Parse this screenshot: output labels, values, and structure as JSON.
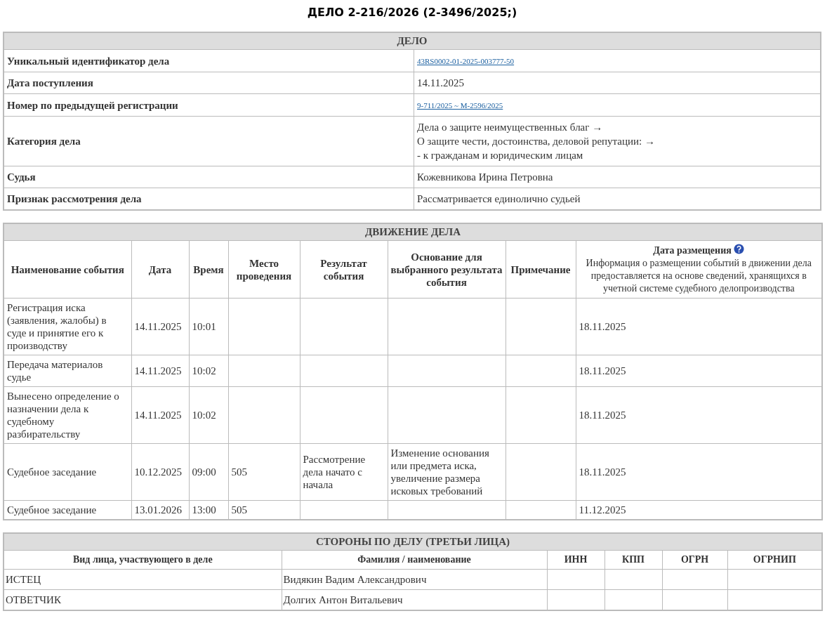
{
  "title": "ДЕЛО 2-216/2026 (2-3496/2025;)",
  "case": {
    "heading": "ДЕЛО",
    "rows": [
      {
        "label": "Уникальный идентификатор дела",
        "kind": "link",
        "lines": [
          "43RS0002-01-2025-003777-50"
        ]
      },
      {
        "label": "Дата поступления",
        "kind": "text",
        "lines": [
          "14.11.2025"
        ]
      },
      {
        "label": "Номер по предыдущей регистрации",
        "kind": "link",
        "lines": [
          "9-711/2025 ~ М-2596/2025"
        ]
      },
      {
        "label": "Категория дела",
        "kind": "text",
        "lines": [
          "Дела о защите неимущественных благ →",
          "О защите чести, достоинства, деловой репутации: →",
          "- к гражданам и юридическим лицам"
        ]
      },
      {
        "label": "Судья",
        "kind": "text",
        "lines": [
          "Кожевникова Ирина Петровна"
        ]
      },
      {
        "label": "Признак рассмотрения дела",
        "kind": "text",
        "lines": [
          "Рассматривается единолично судьей"
        ]
      }
    ]
  },
  "movement": {
    "heading": "ДВИЖЕНИЕ ДЕЛА",
    "columns": [
      "Наименование события",
      "Дата",
      "Время",
      "Место проведения",
      "Результат события",
      "Основание для выбранного результата события",
      "Примечание"
    ],
    "placed_column": {
      "label": "Дата размещения",
      "note": "Информация о размещении событий в движении дела предоставляется на основе сведений, хранящихся в учетной системе судебного делопроизводства"
    },
    "rows": [
      [
        "Регистрация иска (заявления, жалобы) в суде и принятие его к производству",
        "14.11.2025",
        "10:01",
        "",
        "",
        "",
        "",
        "18.11.2025"
      ],
      [
        "Передача материалов судье",
        "14.11.2025",
        "10:02",
        "",
        "",
        "",
        "",
        "18.11.2025"
      ],
      [
        "Вынесено определение о назначении дела к судебному разбирательству",
        "14.11.2025",
        "10:02",
        "",
        "",
        "",
        "",
        "18.11.2025"
      ],
      [
        "Судебное заседание",
        "10.12.2025",
        "09:00",
        "505",
        "Рассмотрение дела начато с начала",
        "Изменение основания или предмета иска, увеличение размера исковых требований",
        "",
        "18.11.2025"
      ],
      [
        "Судебное заседание",
        "13.01.2026",
        "13:00",
        "505",
        "",
        "",
        "",
        "11.12.2025"
      ]
    ]
  },
  "parties": {
    "heading": "СТОРОНЫ ПО ДЕЛУ (ТРЕТЬИ ЛИЦА)",
    "columns": [
      "Вид лица, участвующего в деле",
      "Фамилия / наименование",
      "ИНН",
      "КПП",
      "ОГРН",
      "ОГРНИП"
    ],
    "rows": [
      [
        "ИСТЕЦ",
        "Видякин Вадим Александрович",
        "",
        "",
        "",
        ""
      ],
      [
        "ОТВЕТЧИК",
        "Долгих Антон Витальевич",
        "",
        "",
        "",
        ""
      ]
    ]
  }
}
